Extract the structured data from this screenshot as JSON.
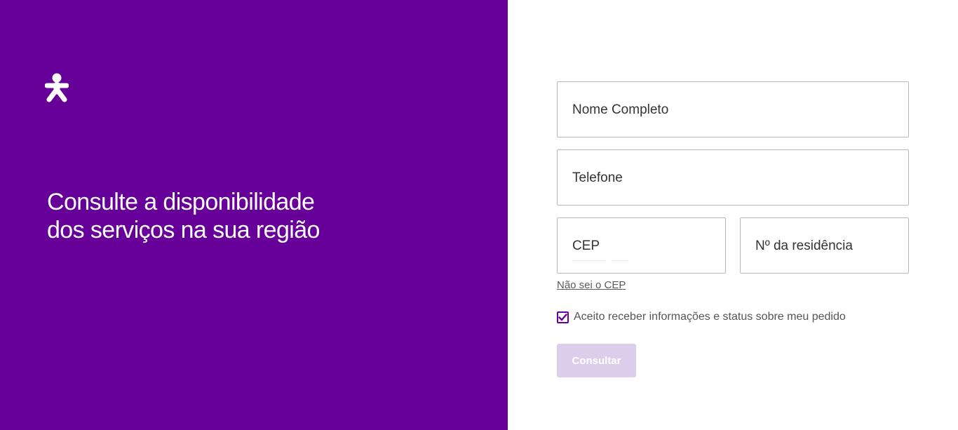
{
  "brand": {
    "logo_icon": "person-icon",
    "primary_color": "#660099",
    "button_disabled_color": "#dccdea"
  },
  "hero": {
    "line1": "Consulte a disponibilidade",
    "line2": "dos serviços na sua região"
  },
  "form": {
    "nome_label": "Nome Completo",
    "telefone_label": "Telefone",
    "cep_label": "CEP",
    "numero_label": "Nº da residência",
    "cep_help_link": "Não sei o CEP",
    "consent_label": "Aceito receber informações e status sobre meu pedido",
    "consent_checked": true,
    "submit_label": "Consultar"
  }
}
